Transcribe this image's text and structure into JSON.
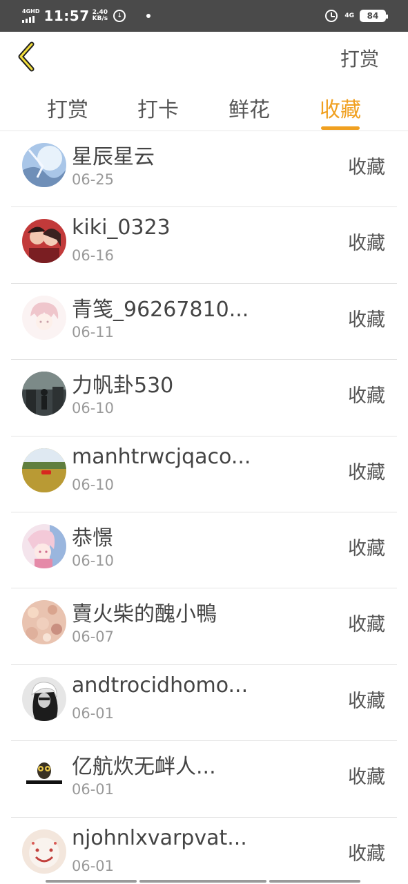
{
  "status_bar": {
    "network": "4GHD",
    "time": "11:57",
    "speed_value": "2.40",
    "speed_unit": "KB/s",
    "signal_type": "4G",
    "battery": "84"
  },
  "header": {
    "back_icon": "chevron-left-icon",
    "action_label": "打赏"
  },
  "tabs": [
    {
      "label": "打赏",
      "active": false
    },
    {
      "label": "打卡",
      "active": false
    },
    {
      "label": "鲜花",
      "active": false
    },
    {
      "label": "收藏",
      "active": true
    }
  ],
  "accent_color": "#f0a020",
  "list": [
    {
      "name": "星辰星云",
      "date": "06-25",
      "action": "收藏"
    },
    {
      "name": "kiki_0323",
      "date": "06-16",
      "action": "收藏"
    },
    {
      "name": "青笺_96267810...",
      "date": "06-11",
      "action": "收藏"
    },
    {
      "name": "力帆卦530",
      "date": "06-10",
      "action": "收藏"
    },
    {
      "name": "manhtrwcjqaco...",
      "date": "06-10",
      "action": "收藏"
    },
    {
      "name": "恭憬",
      "date": "06-10",
      "action": "收藏"
    },
    {
      "name": "賣火柴的醜小鴨",
      "date": "06-07",
      "action": "收藏"
    },
    {
      "name": "andtrocidhomo...",
      "date": "06-01",
      "action": "收藏"
    },
    {
      "name": "亿航炊无衅人...",
      "date": "06-01",
      "action": "收藏"
    },
    {
      "name": "njohnlxvarpvat...",
      "date": "06-01",
      "action": "收藏"
    }
  ]
}
